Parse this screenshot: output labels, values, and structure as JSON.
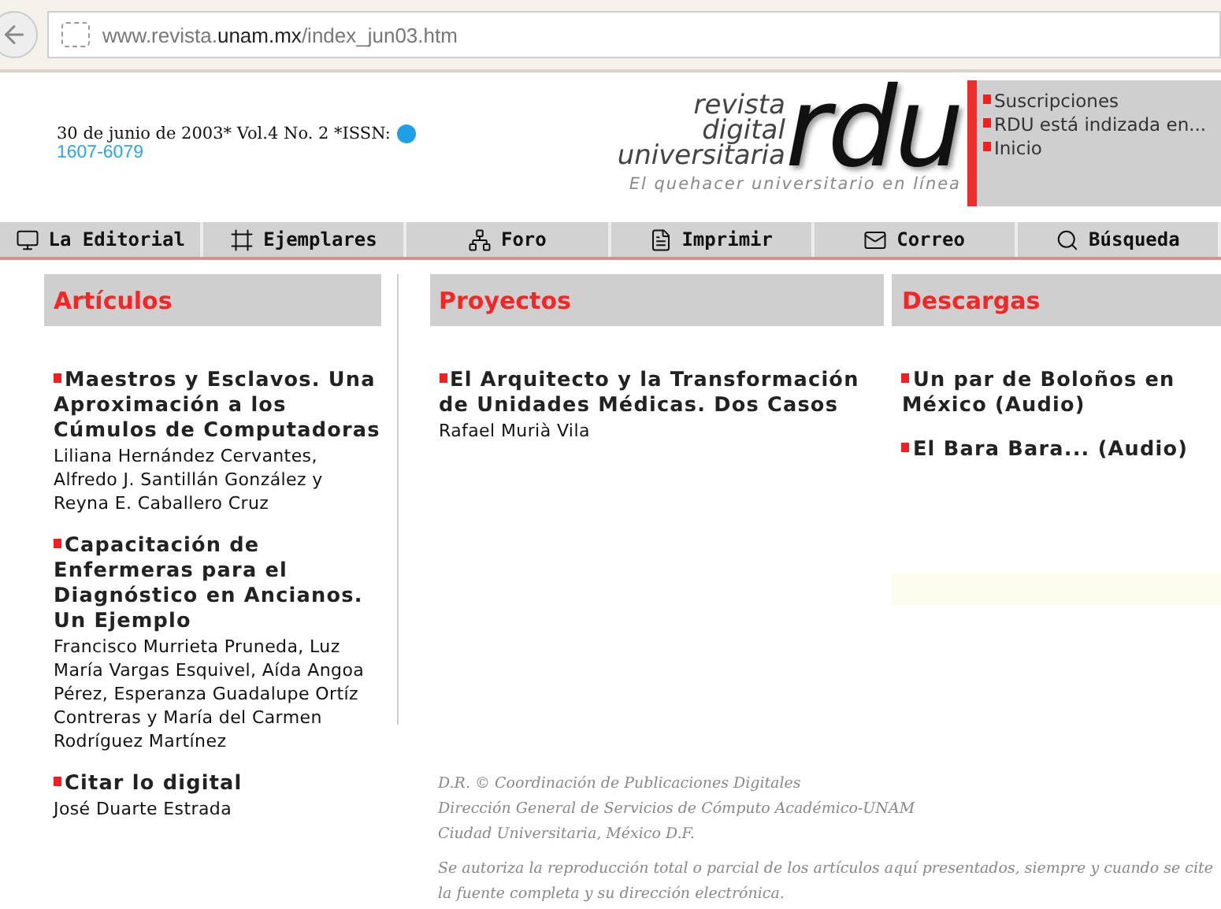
{
  "browser": {
    "url": "www.revista.**unam.mx**/index_jun03.htm"
  },
  "header": {
    "issue_line": "30 de junio de 2003* Vol.4 No. 2 *ISSN:",
    "issn": "1607-6079",
    "logo": {
      "words": [
        "revista",
        "digital",
        "universitaria"
      ],
      "letters": "rdu",
      "tagline": "El quehacer universitario en línea"
    },
    "links": [
      "Suscripciones",
      "RDU está indizada en...",
      "Inicio"
    ]
  },
  "nav": [
    {
      "label": "La Editorial"
    },
    {
      "label": "Ejemplares"
    },
    {
      "label": "Foro"
    },
    {
      "label": "Imprimir"
    },
    {
      "label": "Correo"
    },
    {
      "label": "Búsqueda"
    }
  ],
  "columns": [
    {
      "title": "Artículos",
      "items": [
        {
          "title": "Maestros y Esclavos. Una Aproximación a los Cúmulos de Computadoras",
          "authors": "Liliana Hernández Cervantes, Alfredo J. Santillán González y Reyna E. Caballero Cruz"
        },
        {
          "title": "Capacitación de Enfermeras para el Diagnóstico en Ancianos. Un Ejemplo",
          "authors": "Francisco Murrieta Pruneda, Luz María Vargas Esquivel, Aída Angoa Pérez, Esperanza Guadalupe Ortíz Contreras y María del Carmen Rodríguez Martínez"
        },
        {
          "title": "Citar lo digital",
          "authors": "José Duarte Estrada"
        }
      ]
    },
    {
      "title": "Proyectos",
      "items": [
        {
          "title": "El Arquitecto y la Transformación de Unidades Médicas. Dos Casos",
          "authors": "Rafael Murià Vila"
        }
      ]
    },
    {
      "title": "Descargas",
      "items": [
        {
          "title": "Un par de Boloños en México (Audio)"
        },
        {
          "title": "El Bara Bara... (Audio)"
        }
      ]
    }
  ],
  "footer": {
    "credits": [
      "D.R. © Coordinación de Publicaciones Digitales",
      "Dirección General de Servicios de Cómputo Académico-UNAM",
      "Ciudad Universitaria, México D.F."
    ],
    "notice": "Se autoriza la reproducción total o parcial de los artículos aquí presentados, siempre y cuando se cite la fuente completa y su dirección electrónica."
  }
}
